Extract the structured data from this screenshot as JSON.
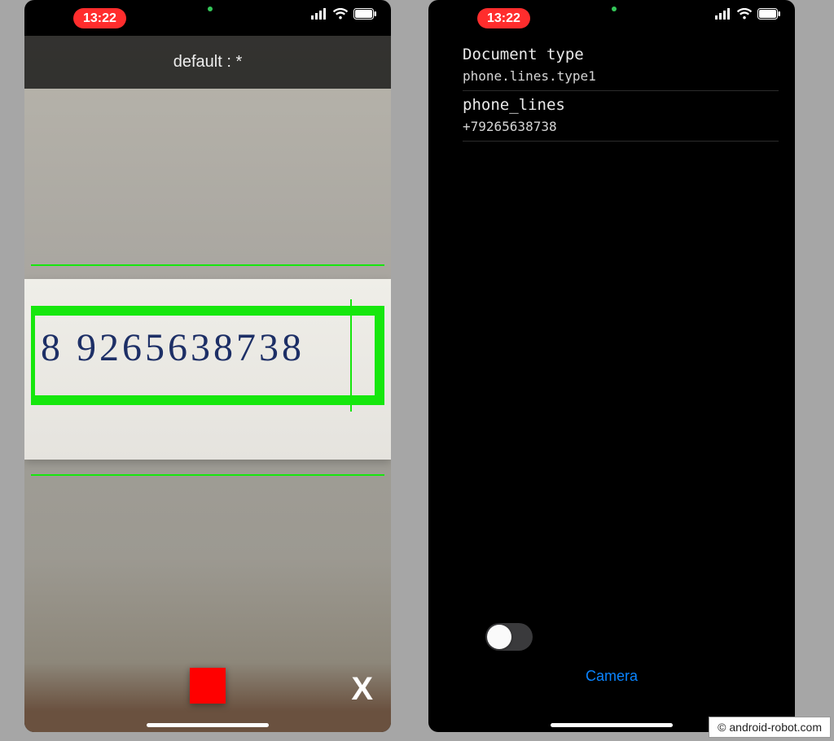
{
  "status": {
    "time": "13:22"
  },
  "left": {
    "header_label": "default : *",
    "handwritten_text": "8 9265638738",
    "close_label": "X"
  },
  "right": {
    "section1_title": "Document type",
    "section1_value": "phone.lines.type1",
    "section2_title": "phone_lines",
    "section2_value": "+79265638738",
    "camera_link_label": "Camera"
  },
  "watermark": "© android-robot.com"
}
